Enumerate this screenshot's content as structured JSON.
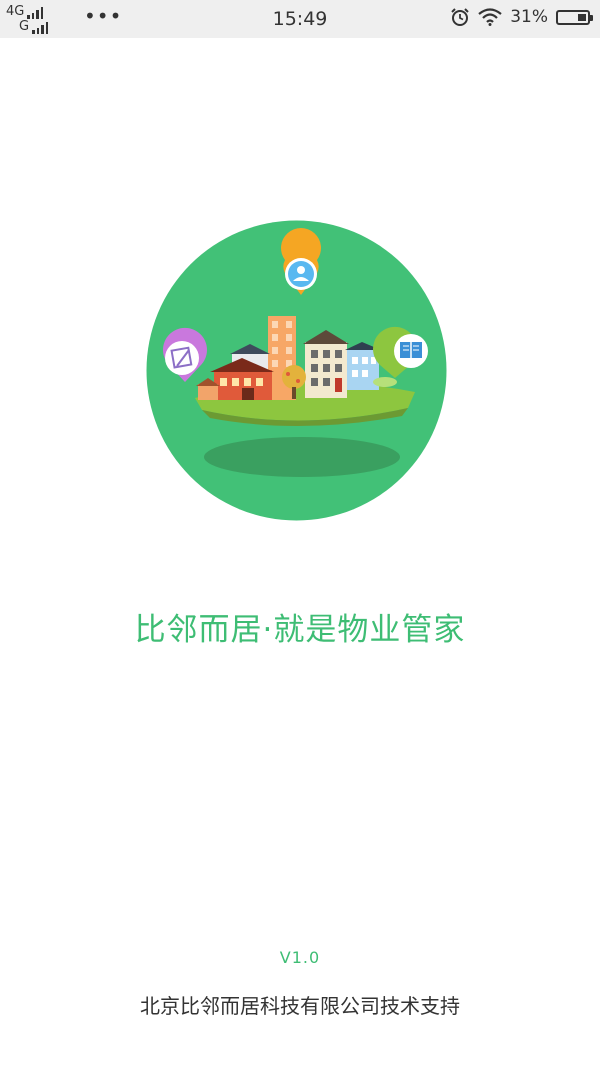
{
  "status_bar": {
    "network_1": "4G",
    "network_2": "G",
    "more": "•••",
    "time": "15:49",
    "icons": [
      "alarm-icon",
      "wifi-icon",
      "battery-icon"
    ],
    "battery_percent": "31%",
    "battery_level": 0.31
  },
  "splash": {
    "slogan": "比邻而居·就是物业管家",
    "version": "V1.0",
    "company": "北京比邻而居科技有限公司技术支持",
    "illustration_icons": [
      "person-pin-icon",
      "edit-pin-icon",
      "book-pin-icon"
    ]
  },
  "colors": {
    "brand_green": "#3ebd74",
    "circle_green": "#42c177",
    "status_bar_bg": "#efefef"
  }
}
